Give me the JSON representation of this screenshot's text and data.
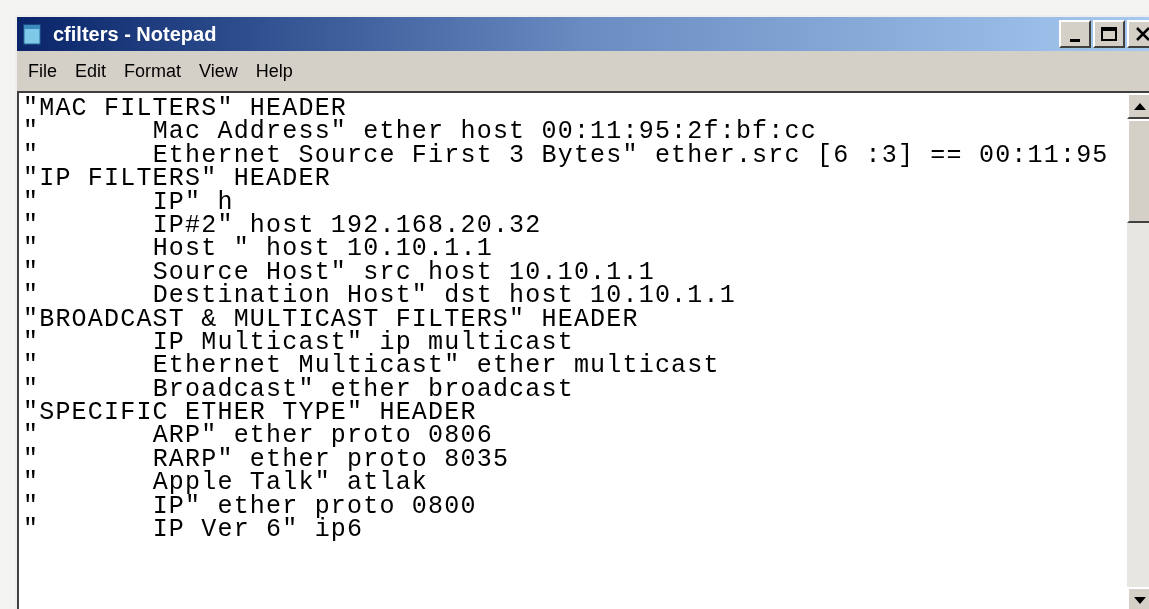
{
  "window": {
    "title": "cfilters - Notepad"
  },
  "menu": [
    {
      "label": "File"
    },
    {
      "label": "Edit"
    },
    {
      "label": "Format"
    },
    {
      "label": "View"
    },
    {
      "label": "Help"
    }
  ],
  "lines": [
    "\"MAC FILTERS\" HEADER",
    "\"\tMac Address\" ether host 00:11:95:2f:bf:cc",
    "\"\tEthernet Source First 3 Bytes\" ether.src [6 :3] == 00:11:95",
    "\"IP FILTERS\" HEADER",
    "\"\tIP\" h",
    "\"\tIP#2\" host 192.168.20.32",
    "\"\tHost \" host 10.10.1.1",
    "\"\tSource Host\" src host 10.10.1.1",
    "\"\tDestination Host\" dst host 10.10.1.1",
    "\"BROADCAST & MULTICAST FILTERS\" HEADER",
    "\"\tIP Multicast\" ip multicast",
    "\"\tEthernet Multicast\" ether multicast",
    "\"\tBroadcast\" ether broadcast",
    "\"SPECIFIC ETHER TYPE\" HEADER",
    "\"\tARP\" ether proto 0806",
    "\"\tRARP\" ether proto 8035",
    "\"\tApple Talk\" atlak",
    "\"\tIP\" ether proto 0800",
    "\"\tIP Ver 6\" ip6"
  ]
}
